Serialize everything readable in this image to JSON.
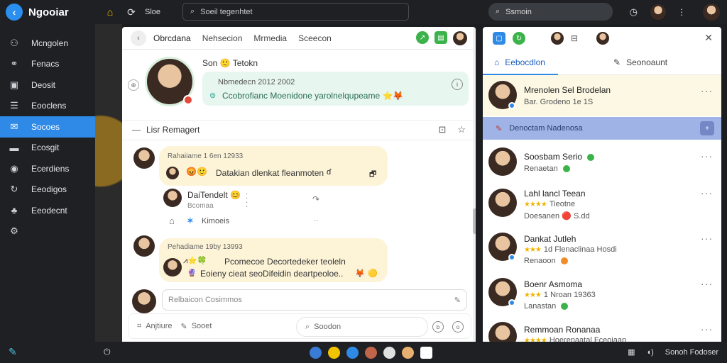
{
  "topbar": {
    "app_name": "Ngooiar",
    "nav_text": "Sloe",
    "search_placeholder": "Soeil tegenhtet",
    "search2_placeholder": "Ssmoin",
    "icons": [
      "home-icon",
      "activity-icon",
      "clock-icon",
      "more-icon"
    ]
  },
  "sidebar": {
    "items": [
      {
        "label": "Mcngolen",
        "icon": "people-icon"
      },
      {
        "label": "Fenacs",
        "icon": "link-icon"
      },
      {
        "label": "Deosit",
        "icon": "bag-icon"
      },
      {
        "label": "Eooclens",
        "icon": "list-icon"
      },
      {
        "label": "Socoes",
        "icon": "chat-icon",
        "active": true
      },
      {
        "label": "Ecosgit",
        "icon": "folder-icon"
      },
      {
        "label": "Ecerdiens",
        "icon": "user-icon"
      },
      {
        "label": "Eeodigos",
        "icon": "refresh-icon"
      },
      {
        "label": "Eeodecnt",
        "icon": "group-icon"
      }
    ]
  },
  "center": {
    "tabs": [
      "Obrcdana",
      "Nehsecion",
      "Mrmedia",
      "Sceecon"
    ],
    "profile": {
      "name": "Son 🙂 Tetokn",
      "status_date": "Nbmedecn 2012 2002",
      "status_text": "Ccobrofianc Moenidone yarolnelqupeame ⭐🦊"
    },
    "section_title": "Lisr Remagert",
    "messages": [
      {
        "meta": "Rahaiiame 1 6en 12933",
        "text": "Datakian dlenkat fleanmoten",
        "reply_name": "DaiTendelt 😊",
        "reply_sub": "Bcomaa",
        "reply2": "Kimoeis"
      },
      {
        "meta": "Pehadiame 19by 13993",
        "line1": "Pcomecoe Decortedeker teoleln",
        "line2": "Eoieny cieat seoDifeidin deartpeoloe.."
      }
    ],
    "composer_placeholder": "Relbaicon Cosimmos",
    "toolbar": {
      "item1": "Anjtiure",
      "item2": "Sooet",
      "search": "Soodon"
    }
  },
  "right": {
    "tabs": [
      "Eebocdlon",
      "Seonoaunt"
    ],
    "highlight": "Denoctam Nadenosa",
    "cards": [
      {
        "name": "Mrenolen Sel Brodelan",
        "sub": "Bar. Grodeno 1e 1S"
      },
      {
        "name": "Soosbam Serio",
        "sub": "Renaetan"
      },
      {
        "name": "Lahl lancl Teean",
        "stars": "★★★★",
        "stars_text": "Tieotne",
        "sub": "Doesanen 🔴 S.dd"
      },
      {
        "name": "Dankat Jutleh",
        "stars": "★★★",
        "stars_text": "1d Flenaclinaa Hosdi",
        "sub": "Renaoon"
      },
      {
        "name": "Boenr Asmoma",
        "stars": "★★★",
        "stars_text": "1 Nroan 19363",
        "sub": "Lanastan"
      },
      {
        "name": "Remmoan Ronanaa",
        "stars": "★★★★",
        "stars_text": "Hoerenaatal Fceoiaan",
        "sub": ""
      }
    ]
  },
  "bottombar": {
    "right_text": "Sonoh Fodoser"
  },
  "colors": {
    "accent": "#2e8ae6",
    "dark_bg": "#1e2024",
    "bubble_yellow": "#fdf4d8",
    "bubble_green": "#e7f6ee"
  }
}
